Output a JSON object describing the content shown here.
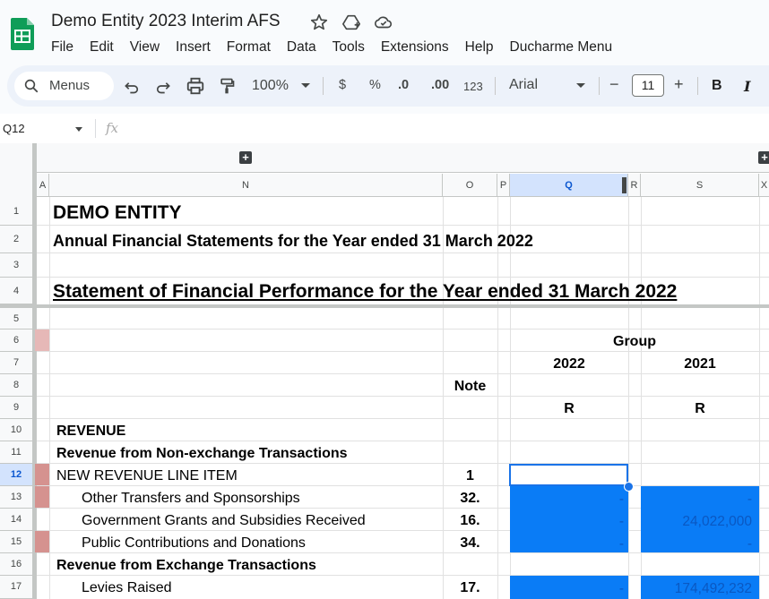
{
  "doc": {
    "title": "Demo Entity 2023 Interim AFS"
  },
  "menu": [
    "File",
    "Edit",
    "View",
    "Insert",
    "Format",
    "Data",
    "Tools",
    "Extensions",
    "Help",
    "Ducharme Menu"
  ],
  "toolbar": {
    "search_label": "Menus",
    "zoom": "100%",
    "currency": "$",
    "percent": "%",
    "dec_decrease": ".0",
    "dec_increase": ".00",
    "number_format": "123",
    "font": "Arial",
    "font_size": "11",
    "minus": "−",
    "plus": "+",
    "bold": "B",
    "italic": "I"
  },
  "formula_bar": {
    "name_box": "Q12",
    "fx": "fx"
  },
  "columns": {
    "A": "A",
    "N": "N",
    "O": "O",
    "P": "P",
    "Q": "Q",
    "R": "R",
    "S": "S",
    "T": "X"
  },
  "rows": [
    "1",
    "2",
    "3",
    "4",
    "5",
    "6",
    "7",
    "8",
    "9",
    "10",
    "11",
    "12",
    "13",
    "14",
    "15",
    "16",
    "17"
  ],
  "sheet": {
    "entity": "DEMO ENTITY",
    "subtitle": "Annual Financial Statements for the Year ended 31 March 2022",
    "statement": "Statement of Financial Performance for the Year ended 31 March 2022",
    "group": "Group",
    "year_2022": "2022",
    "year_2021": "2021",
    "note": "Note",
    "unit_q": "R",
    "unit_s": "R",
    "lines": [
      {
        "label": "REVENUE",
        "note": "",
        "q": "",
        "s": ""
      },
      {
        "label": "Revenue from Non-exchange Transactions",
        "note": "",
        "q": "",
        "s": ""
      },
      {
        "label": "NEW REVENUE LINE ITEM",
        "note": "1",
        "q": "",
        "s": ""
      },
      {
        "label": "Other Transfers and Sponsorships",
        "note": "32.",
        "q": "-",
        "s": "-"
      },
      {
        "label": "Government Grants and Subsidies Received",
        "note": "16.",
        "q": "-",
        "s": "24,022,000"
      },
      {
        "label": "Public Contributions and Donations",
        "note": "34.",
        "q": "-",
        "s": "-"
      },
      {
        "label": "Revenue from Exchange Transactions",
        "note": "",
        "q": "",
        "s": ""
      },
      {
        "label": "Levies Raised",
        "note": "17.",
        "q": "-",
        "s": "174,492,232"
      }
    ]
  }
}
